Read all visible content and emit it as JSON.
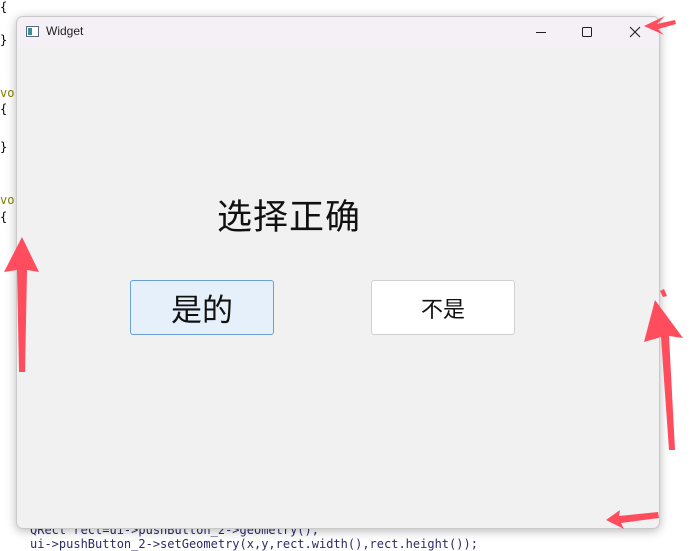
{
  "background_code": {
    "lines": [
      "{",
      "}",
      "vo",
      "{",
      "}",
      "vo",
      "{"
    ],
    "bottom_line_1": "QRect rect=ui->pushButton_2->geometry();",
    "bottom_line_2": "ui->pushButton_2->setGeometry(x,y,rect.width(),rect.height());"
  },
  "window": {
    "title": "Widget",
    "minimize_glyph": "—",
    "close_glyph": "✕"
  },
  "content": {
    "heading": "选择正确",
    "yes_button": "是的",
    "no_button": "不是"
  },
  "colors": {
    "annotation_arrow": "#ff4d5e",
    "yes_button_bg": "#e5f0fb",
    "yes_button_border": "#6aa0d6",
    "window_bg": "#f2f1f1"
  },
  "icons": [
    "window-app-icon",
    "minimize-icon",
    "maximize-icon",
    "close-icon",
    "annotation-arrow-icon"
  ]
}
